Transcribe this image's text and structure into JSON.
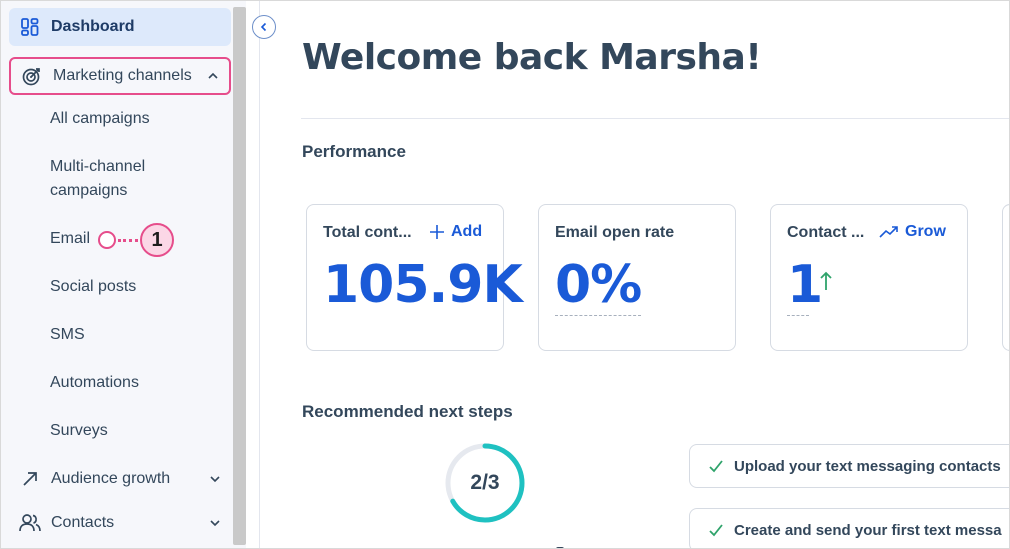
{
  "sidebar": {
    "dashboard_label": "Dashboard",
    "marketing_label": "Marketing channels",
    "sub_items": [
      "All campaigns",
      "Multi-channel",
      "campaigns",
      "Email",
      "Social posts",
      "SMS",
      "Automations",
      "Surveys"
    ],
    "audience_label": "Audience growth",
    "contacts_label": "Contacts"
  },
  "annotation": {
    "step_number": "1"
  },
  "main": {
    "welcome": "Welcome back Marsha!",
    "performance_title": "Performance",
    "cards": [
      {
        "label": "Total cont...",
        "action": "Add",
        "value": "105.9K"
      },
      {
        "label": "Email open rate",
        "value": "0%"
      },
      {
        "label": "Contact ...",
        "action": "Grow",
        "value": "1"
      }
    ],
    "next_steps_title": "Recommended next steps",
    "progress": {
      "text": "2/3",
      "fraction": 0.667
    },
    "tasks": [
      "Upload your text messaging contacts",
      "Create and send your first text messa"
    ]
  },
  "colors": {
    "accent": "#1a5ad7",
    "highlight": "#e64d8b",
    "progress": "#1fc1c1",
    "success": "#2fa36b"
  }
}
